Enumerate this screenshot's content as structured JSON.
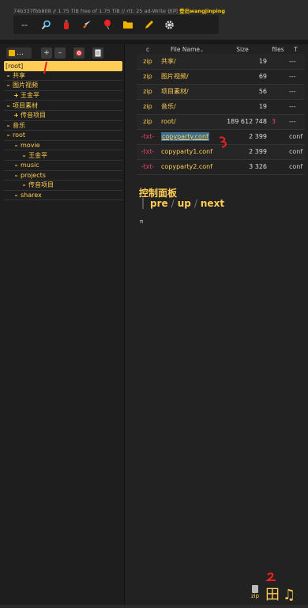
{
  "status": {
    "text": "74b337fbb808 // 1.75 TiB free of 1.75 TiB // rtt: 25  ad-Write 访问",
    "user": "登出wangjinping"
  },
  "toolbar": {
    "dash": "--",
    "icons": [
      "search-icon",
      "fire-extinguisher-icon",
      "rocket-icon",
      "balloon-icon",
      "folder-icon",
      "pen-icon",
      "gear-icon"
    ]
  },
  "tree_head": {
    "folder_label": "…",
    "plus": "+",
    "minus": "–"
  },
  "tree": [
    {
      "sym": "",
      "label": "[root]",
      "selected": true
    },
    {
      "sym": "–",
      "label": "共享"
    },
    {
      "sym": "–",
      "label": "图片视频"
    },
    {
      "sym": "+",
      "label": "王金平",
      "indent": 1
    },
    {
      "sym": "–",
      "label": "项目素材"
    },
    {
      "sym": "+",
      "label": "传音项目",
      "indent": 1
    },
    {
      "sym": "–",
      "label": "音乐"
    },
    {
      "sym": "–",
      "label": "root"
    },
    {
      "sym": "–",
      "label": "movie",
      "indent": 1
    },
    {
      "sym": "–",
      "label": "王金平",
      "indent": 2
    },
    {
      "sym": "–",
      "label": "music",
      "indent": 1
    },
    {
      "sym": "–",
      "label": "projects",
      "indent": 1
    },
    {
      "sym": "–",
      "label": "传音项目",
      "indent": 2
    },
    {
      "sym": "–",
      "label": "sharex",
      "indent": 1
    }
  ],
  "table": {
    "headers": [
      "c",
      "File Name",
      "Size",
      "files",
      "T"
    ],
    "rows": [
      {
        "c": "zip",
        "name": "共享/",
        "size": "19",
        "files": "",
        "t": "---"
      },
      {
        "c": "zip",
        "name": "图片视频/",
        "size": "69",
        "files": "",
        "t": "---"
      },
      {
        "c": "zip",
        "name": "项目素材/",
        "size": "56",
        "files": "",
        "t": "---"
      },
      {
        "c": "zip",
        "name": "音乐/",
        "size": "19",
        "files": "",
        "t": "---"
      },
      {
        "c": "zip",
        "name": "root/",
        "size": "189 612 748",
        "files": "3",
        "t": "---"
      },
      {
        "c": "-txt-",
        "name": "copyparty.conf",
        "size": "2 399",
        "files": "",
        "t": "conf"
      },
      {
        "c": "-txt-",
        "name": "copyparty1.conf",
        "size": "2 399",
        "files": "",
        "t": "conf"
      },
      {
        "c": "-txt-",
        "name": "copyparty2.conf",
        "size": "3 326",
        "files": "",
        "t": "conf"
      }
    ]
  },
  "panel": {
    "title": "控制面板",
    "pre": "pre",
    "up": "up",
    "next": "next",
    "sep": "/",
    "pi": "π"
  },
  "dock": {
    "zip_label": "zip",
    "grid_glyph": "田",
    "music_glyph": "♫"
  }
}
